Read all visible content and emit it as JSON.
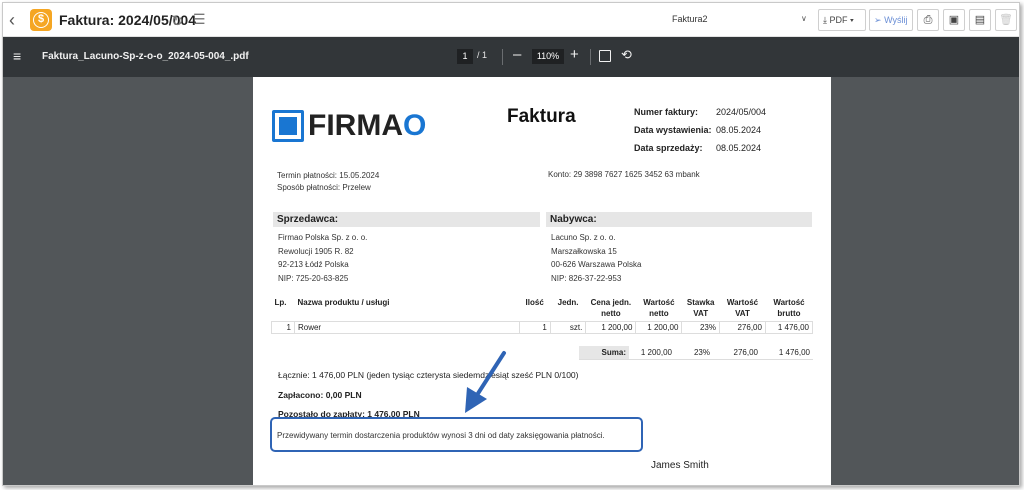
{
  "header": {
    "title": "Faktura: 2024/05/004",
    "template_select": "Faktura2",
    "pdf_label": "PDF",
    "send_label": "Wyślij"
  },
  "pdfbar": {
    "filename": "Faktura_Lacuno-Sp-z-o-o_2024-05-004_.pdf",
    "page_current": "1",
    "page_total": "/ 1",
    "zoom": "110%"
  },
  "invoice": {
    "title": "Faktura",
    "logo_text": "FIRMA",
    "logo_o": "O",
    "meta": [
      {
        "k": "Numer faktury:",
        "v": "2024/05/004"
      },
      {
        "k": "Data wystawienia:",
        "v": "08.05.2024"
      },
      {
        "k": "Data sprzedaży:",
        "v": "08.05.2024"
      }
    ],
    "payment_due": "Termin płatności: 15.05.2024",
    "payment_method": "Sposób płatności: Przelew",
    "account": "Konto: 29 3898 7627 1625 3452 63 mbank",
    "seller": {
      "header": "Sprzedawca:",
      "lines": [
        "Firmao Polska Sp. z o. o.",
        "Rewolucji 1905 R. 82",
        "92-213 Łódź Polska",
        "NIP: 725-20-63-825"
      ]
    },
    "buyer": {
      "header": "Nabywca:",
      "lines": [
        "Lacuno Sp. z o. o.",
        "Marszałkowska 15",
        "00-626 Warszawa Polska",
        "NIP: 826-37-22-953"
      ]
    },
    "table": {
      "headers": [
        "Lp.",
        "Nazwa produktu / usługi",
        "Ilość",
        "Jedn.",
        "Cena jedn. netto",
        "Wartość netto",
        "Stawka VAT",
        "Wartość VAT",
        "Wartość brutto"
      ],
      "rows": [
        [
          "1",
          "Rower",
          "1",
          "szt.",
          "1 200,00",
          "1 200,00",
          "23%",
          "276,00",
          "1 476,00"
        ]
      ]
    },
    "sum": {
      "label": "Suma:",
      "netto": "1 200,00",
      "vat_rate": "23%",
      "vat": "276,00",
      "brutto": "1 476,00"
    },
    "total_words": "Łącznie: 1 476,00 PLN  (jeden tysiąc czterysta siedemdziesiąt sześć  PLN 0/100)",
    "paid": "Zapłacono: 0,00 PLN",
    "remaining": "Pozostało do zapłaty: 1 476,00 PLN",
    "note": "Przewidywany termin dostarczenia produktów wynosi 3 dni od daty zaksięgowania płatności.",
    "signature": "James Smith"
  },
  "colors": {
    "accent": "#2f64b5",
    "brand": "#1976d2",
    "coin": "#f5a623",
    "viewer_bg": "#525659",
    "toolbar_bg": "#323639"
  }
}
